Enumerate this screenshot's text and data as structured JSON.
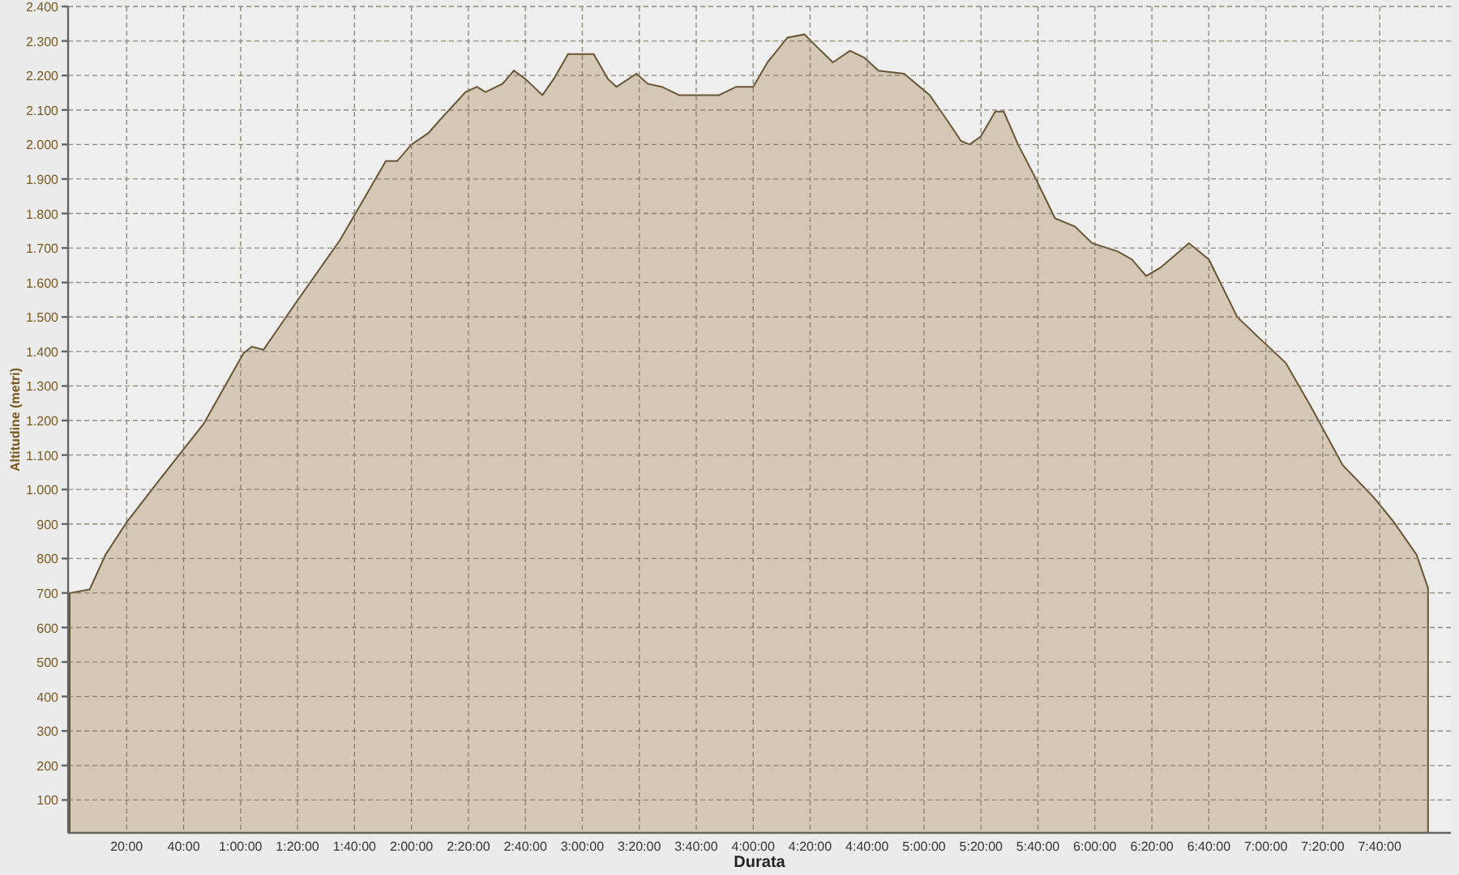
{
  "chart_data": {
    "type": "area",
    "xlabel": "Durata",
    "ylabel": "Altitudine (metri)",
    "x": [
      0,
      7,
      12.5,
      20,
      32,
      47,
      61,
      64,
      68,
      78,
      95,
      111,
      115,
      120,
      126,
      130,
      139,
      143,
      146,
      152,
      156,
      160,
      166,
      170,
      175,
      180,
      184,
      189,
      192,
      199,
      203,
      208,
      214,
      228,
      234,
      240,
      245,
      252,
      258,
      262,
      268,
      274,
      279,
      284,
      293,
      302,
      308,
      313,
      316,
      320,
      325,
      328,
      333,
      339,
      346,
      353,
      359,
      368,
      373,
      378,
      383,
      393,
      400,
      410,
      416,
      427,
      436,
      447,
      458,
      465,
      473,
      477
    ],
    "series": [
      {
        "color": "#d5c8b5",
        "values": [
          700,
          710,
          810,
          905,
          1033,
          1190,
          1395,
          1414,
          1405,
          1524,
          1724,
          1952,
          1952,
          2000,
          2033,
          2071,
          2152,
          2167,
          2152,
          2176,
          2214,
          2190,
          2143,
          2190,
          2262,
          2262,
          2262,
          2190,
          2167,
          2205,
          2176,
          2167,
          2143,
          2143,
          2167,
          2167,
          2238,
          2310,
          2319,
          2286,
          2238,
          2272,
          2252,
          2214,
          2205,
          2143,
          2071,
          2010,
          2000,
          2024,
          2095,
          2095,
          2000,
          1905,
          1786,
          1762,
          1714,
          1690,
          1667,
          1619,
          1643,
          1714,
          1667,
          1500,
          1452,
          1367,
          1238,
          1071,
          976,
          905,
          810,
          714
        ]
      }
    ],
    "grid": true,
    "xlim": [
      0,
      485
    ],
    "ylim": [
      0,
      2400
    ],
    "xticks": [
      {
        "value": 20,
        "label": "20:00"
      },
      {
        "value": 40,
        "label": "40:00"
      },
      {
        "value": 60,
        "label": "1:00:00"
      },
      {
        "value": 80,
        "label": "1:20:00"
      },
      {
        "value": 100,
        "label": "1:40:00"
      },
      {
        "value": 120,
        "label": "2:00:00"
      },
      {
        "value": 140,
        "label": "2:20:00"
      },
      {
        "value": 160,
        "label": "2:40:00"
      },
      {
        "value": 180,
        "label": "3:00:00"
      },
      {
        "value": 200,
        "label": "3:20:00"
      },
      {
        "value": 220,
        "label": "3:40:00"
      },
      {
        "value": 240,
        "label": "4:00:00"
      },
      {
        "value": 260,
        "label": "4:20:00"
      },
      {
        "value": 280,
        "label": "4:40:00"
      },
      {
        "value": 300,
        "label": "5:00:00"
      },
      {
        "value": 320,
        "label": "5:20:00"
      },
      {
        "value": 340,
        "label": "5:40:00"
      },
      {
        "value": 360,
        "label": "6:00:00"
      },
      {
        "value": 380,
        "label": "6:20:00"
      },
      {
        "value": 400,
        "label": "6:40:00"
      },
      {
        "value": 420,
        "label": "7:00:00"
      },
      {
        "value": 440,
        "label": "7:20:00"
      },
      {
        "value": 460,
        "label": "7:40:00"
      }
    ],
    "yticks": [
      100,
      200,
      300,
      400,
      500,
      600,
      700,
      800,
      900,
      {
        "value": 1000,
        "label": "1.000"
      },
      {
        "value": 1100,
        "label": "1.100"
      },
      {
        "value": 1200,
        "label": "1.200"
      },
      {
        "value": 1300,
        "label": "1.300"
      },
      {
        "value": 1400,
        "label": "1.400"
      },
      {
        "value": 1500,
        "label": "1.500"
      },
      {
        "value": 1600,
        "label": "1.600"
      },
      {
        "value": 1700,
        "label": "1.700"
      },
      {
        "value": 1800,
        "label": "1.800"
      },
      {
        "value": 1900,
        "label": "1.900"
      },
      {
        "value": 2000,
        "label": "2.000"
      },
      {
        "value": 2100,
        "label": "2.100"
      },
      {
        "value": 2200,
        "label": "2.200"
      },
      {
        "value": 2300,
        "label": "2.300"
      },
      {
        "value": 2400,
        "label": "2.400"
      }
    ]
  }
}
